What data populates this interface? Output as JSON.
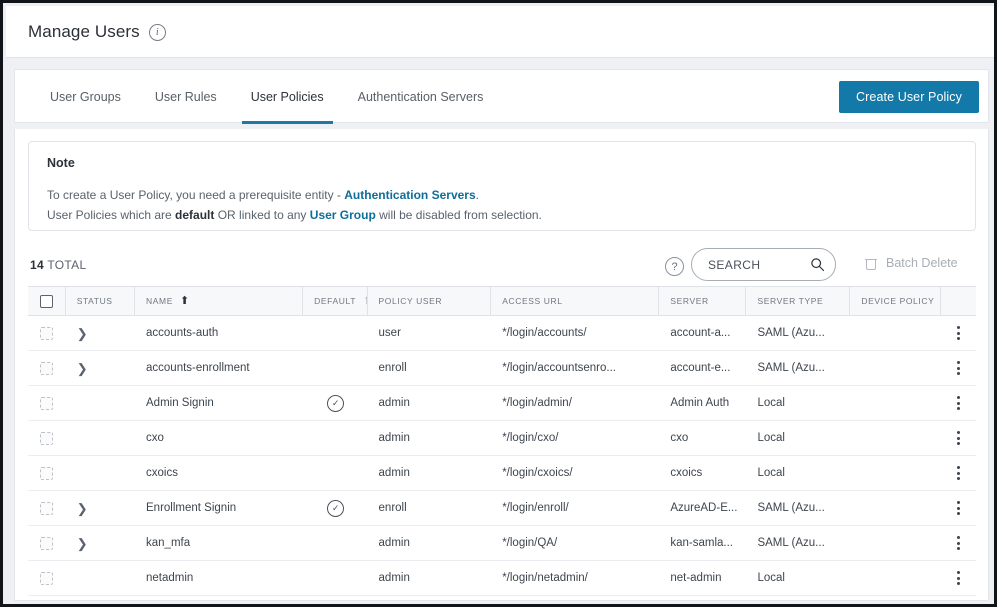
{
  "header": {
    "title": "Manage Users",
    "info_icon": "info-icon"
  },
  "tabs": [
    {
      "label": "User Groups",
      "active": false
    },
    {
      "label": "User Rules",
      "active": false
    },
    {
      "label": "User Policies",
      "active": true
    },
    {
      "label": "Authentication Servers",
      "active": false
    }
  ],
  "actions": {
    "create_user_policy": "Create User Policy",
    "accent_color": "#1279a8"
  },
  "note": {
    "title": "Note",
    "line1_prefix": "To create a User Policy, you need a prerequisite entity - ",
    "line1_link": "Authentication Servers",
    "line1_suffix": ".",
    "line2_prefix": "User Policies which are ",
    "line2_bold1": "default",
    "line2_mid": " OR linked to any ",
    "line2_link": "User Group",
    "line2_suffix": " will be disabled from selection.",
    "link_color": "#0d6e99"
  },
  "toolbar": {
    "total_count": "14",
    "total_label": "TOTAL",
    "help_icon": "question-mark-icon",
    "search_placeholder": "SEARCH",
    "search_value": "",
    "batch_delete": "Batch Delete",
    "batch_delete_enabled": false
  },
  "table": {
    "columns": [
      {
        "key": "checkbox",
        "label": ""
      },
      {
        "key": "status",
        "label": "STATUS"
      },
      {
        "key": "name",
        "label": "NAME",
        "sort": "asc"
      },
      {
        "key": "default",
        "label": "DEFAULT",
        "sort": "asc-light"
      },
      {
        "key": "policy_user",
        "label": "POLICY USER"
      },
      {
        "key": "access_url",
        "label": "ACCESS URL"
      },
      {
        "key": "server",
        "label": "SERVER"
      },
      {
        "key": "server_type",
        "label": "SERVER TYPE"
      },
      {
        "key": "device_policy",
        "label": "DEVICE POLICY"
      }
    ],
    "rows": [
      {
        "expandable": true,
        "name": "accounts-auth",
        "default": false,
        "policy_user": "user",
        "access_url": "*/login/accounts/",
        "server": "account-a...",
        "server_type": "SAML (Azu...",
        "device_policy": ""
      },
      {
        "expandable": true,
        "name": "accounts-enrollment",
        "default": false,
        "policy_user": "enroll",
        "access_url": "*/login/accountsenro...",
        "server": "account-e...",
        "server_type": "SAML (Azu...",
        "device_policy": ""
      },
      {
        "expandable": false,
        "name": "Admin Signin",
        "default": true,
        "policy_user": "admin",
        "access_url": "*/login/admin/",
        "server": "Admin Auth",
        "server_type": "Local",
        "device_policy": ""
      },
      {
        "expandable": false,
        "name": "cxo",
        "default": false,
        "policy_user": "admin",
        "access_url": "*/login/cxo/",
        "server": "cxo",
        "server_type": "Local",
        "device_policy": ""
      },
      {
        "expandable": false,
        "name": "cxoics",
        "default": false,
        "policy_user": "admin",
        "access_url": "*/login/cxoics/",
        "server": "cxoics",
        "server_type": "Local",
        "device_policy": ""
      },
      {
        "expandable": true,
        "name": "Enrollment Signin",
        "default": true,
        "policy_user": "enroll",
        "access_url": "*/login/enroll/",
        "server": "AzureAD-E...",
        "server_type": "SAML (Azu...",
        "device_policy": ""
      },
      {
        "expandable": true,
        "name": "kan_mfa",
        "default": false,
        "policy_user": "admin",
        "access_url": "*/login/QA/",
        "server": "kan-samla...",
        "server_type": "SAML (Azu...",
        "device_policy": ""
      },
      {
        "expandable": false,
        "name": "netadmin",
        "default": false,
        "policy_user": "admin",
        "access_url": "*/login/netadmin/",
        "server": "net-admin",
        "server_type": "Local",
        "device_policy": ""
      }
    ]
  }
}
